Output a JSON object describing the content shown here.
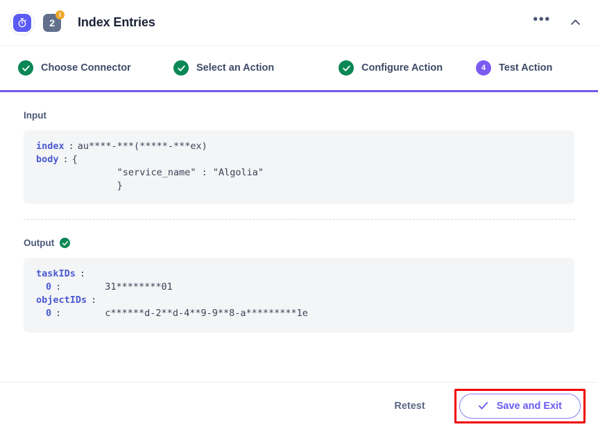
{
  "header": {
    "app_icon": "stopwatch-icon",
    "step_number": "2",
    "info_badge": "i",
    "title": "Index Entries",
    "more_label": "•••",
    "collapse_icon": "chevron-up-icon"
  },
  "stepper": {
    "steps": [
      {
        "label": "Choose Connector",
        "state": "done",
        "marker": "✓"
      },
      {
        "label": "Select an Action",
        "state": "done",
        "marker": "✓"
      },
      {
        "label": "Configure Action",
        "state": "done",
        "marker": "✓"
      },
      {
        "label": "Test Action",
        "state": "active",
        "marker": "4"
      }
    ],
    "accent_color": "#6d5bec",
    "done_color": "#0a8754",
    "active_color": "#7b5cf0"
  },
  "input": {
    "label": "Input",
    "rows": [
      {
        "key": "index",
        "colon": ":",
        "value": "au****-***(*****-***ex)"
      },
      {
        "key": "body",
        "colon": ":",
        "value": "{\n        \"service_name\" : \"Algolia\"\n        }"
      }
    ]
  },
  "output": {
    "label": "Output",
    "status_icon": "check-circle-icon",
    "rows": [
      {
        "key": "taskIDs",
        "colon": ":",
        "value": ""
      },
      {
        "index_key": "0",
        "colon": ":",
        "value": "31********01"
      },
      {
        "key": "objectIDs",
        "colon": ":",
        "value": ""
      },
      {
        "index_key": "0",
        "colon": ":",
        "value": "c******d-2**d-4**9-9**8-a*********1e"
      }
    ]
  },
  "footer": {
    "retest_label": "Retest",
    "save_label": "Save and Exit",
    "save_icon": "check-icon",
    "highlight_color": "#ee0000"
  }
}
